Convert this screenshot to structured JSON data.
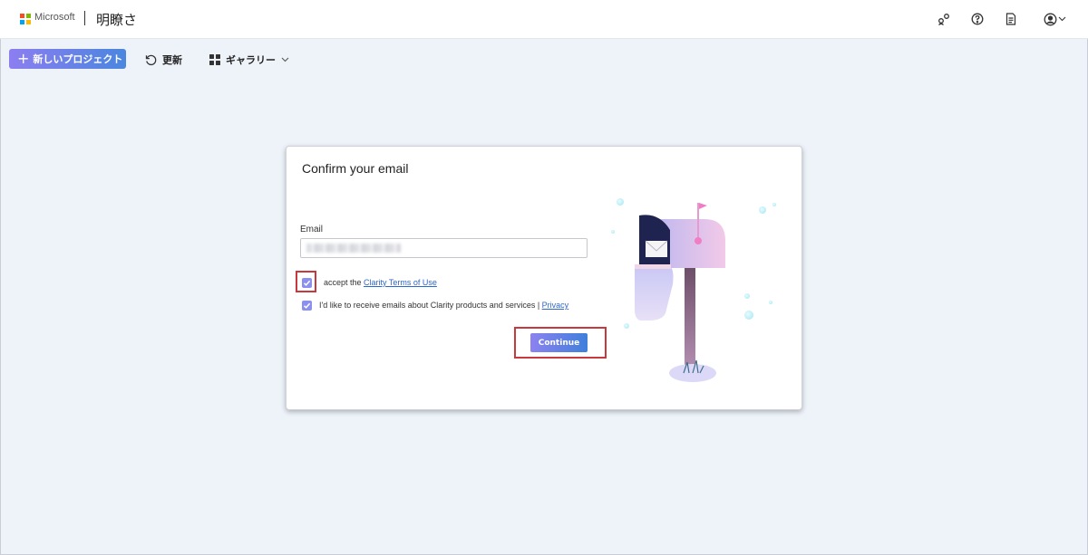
{
  "header": {
    "brand": "Microsoft",
    "app_name": "明瞭さ",
    "icons": [
      "share-icon",
      "help-icon",
      "document-icon",
      "account-icon",
      "chevron-down-icon"
    ],
    "logo_colors": [
      "#f25022",
      "#7fba00",
      "#00a4ef",
      "#ffb900"
    ]
  },
  "toolbar": {
    "new_project_label": "新しいプロジェクト",
    "refresh_label": "更新",
    "gallery_label": "ギャラリー"
  },
  "dialog": {
    "title": "Confirm your email",
    "email_label": "Email",
    "email_value": "",
    "terms_prefix": "accept the ",
    "terms_link": "Clarity Terms of Use",
    "terms_checked": true,
    "marketing_text": "I'd like to receive emails about Clarity products and services | ",
    "privacy_link": "Privacy",
    "marketing_checked": true,
    "continue_label": "Continue"
  },
  "colors": {
    "accent_start": "#8c7ef0",
    "accent_end": "#4a86df",
    "highlight": "#c8393d",
    "link": "#2d67c8"
  }
}
